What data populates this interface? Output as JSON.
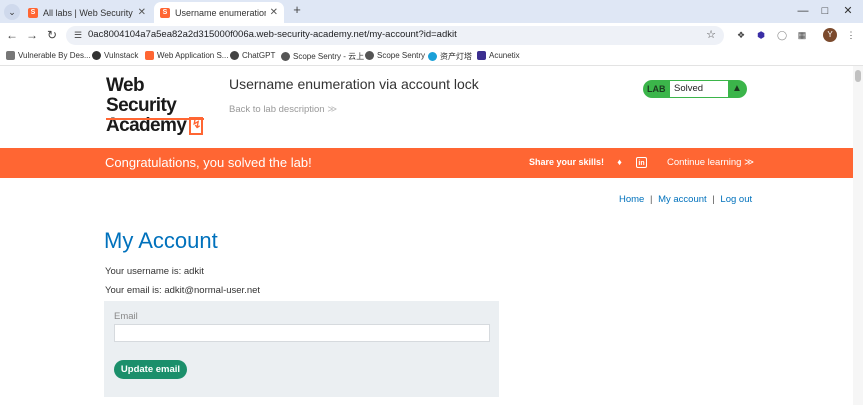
{
  "browser": {
    "tabs": [
      {
        "title": "All labs | Web Security Acade",
        "favicon": "S",
        "active": false
      },
      {
        "title": "Username enumeration via a",
        "favicon": "S",
        "active": true
      }
    ],
    "address": "0ac8004104a7a5ea82a2d315000f006a.web-security-academy.net/my-account?id=adkit",
    "avatar_letter": "Y",
    "bookmarks": [
      {
        "label": "Vulnerable By Des...",
        "icon": "gear-icon"
      },
      {
        "label": "Vulnstack",
        "icon": "globe-icon"
      },
      {
        "label": "Web Application S...",
        "icon": "portswigger-icon"
      },
      {
        "label": "ChatGPT",
        "icon": "chatgpt-icon"
      },
      {
        "label": "Scope Sentry - 云上",
        "icon": "bug-icon"
      },
      {
        "label": "Scope Sentry",
        "icon": "bug-icon"
      },
      {
        "label": "资产灯塔",
        "icon": "lighthouse-icon"
      },
      {
        "label": "Acunetix",
        "icon": "acunetix-icon"
      }
    ]
  },
  "header": {
    "logo_line1": "Web Security",
    "logo_line2": "Academy",
    "lab_title": "Username enumeration via account lock",
    "back_link": "Back to lab description",
    "back_chevron": "≫",
    "lab_badge_word": "LAB",
    "lab_status": "Solved"
  },
  "banner": {
    "message": "Congratulations, you solved the lab!",
    "share_label": "Share your skills!",
    "continue_label": "Continue learning",
    "continue_chevron": "≫"
  },
  "nav": {
    "home": "Home",
    "my_account": "My account",
    "log_out": "Log out",
    "separator": "|"
  },
  "account": {
    "heading": "My Account",
    "username_line": "Your username is: adkit",
    "email_line": "Your email is: adkit@normal-user.net",
    "email_field_label": "Email",
    "email_value": "",
    "update_button": "Update email"
  },
  "colors": {
    "brand_orange": "#ff6633",
    "link_blue": "#0071bc",
    "lab_green": "#3bb54a",
    "button_green": "#1b8f6b"
  }
}
